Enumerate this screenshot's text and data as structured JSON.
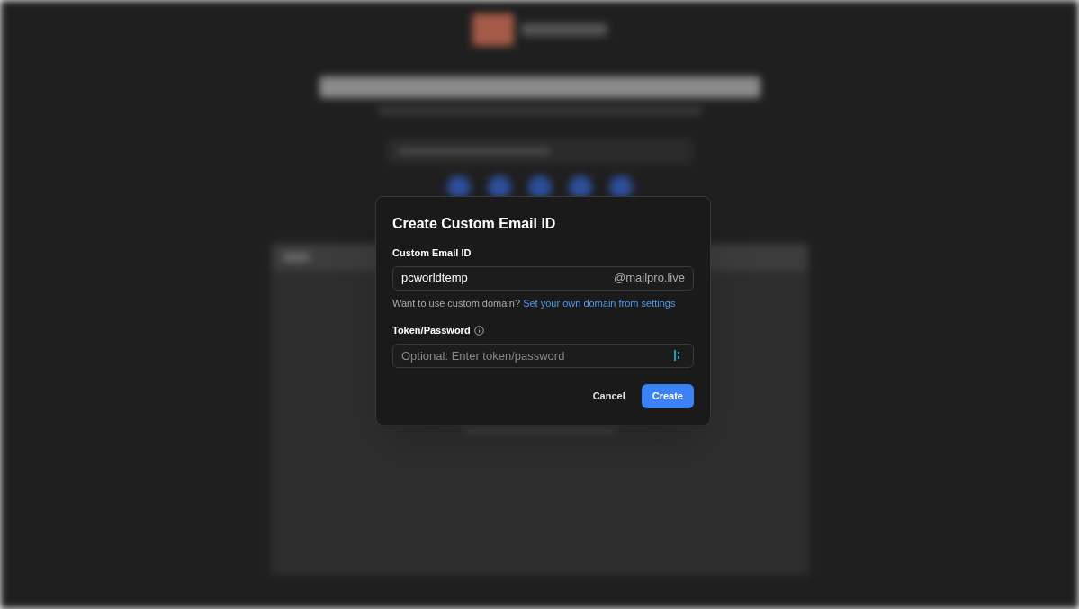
{
  "dialog": {
    "title": "Create Custom Email ID",
    "email_field": {
      "label": "Custom Email ID",
      "value": "pcworldtemp",
      "suffix": "@mailpro.live"
    },
    "helper": {
      "text": "Want to use custom domain?",
      "link": "Set your own domain from settings"
    },
    "token_field": {
      "label": "Token/Password",
      "placeholder": "Optional: Enter token/password"
    },
    "buttons": [
      {
        "label": "Cancel",
        "kind": "secondary"
      },
      {
        "label": "Create",
        "kind": "primary"
      }
    ]
  }
}
